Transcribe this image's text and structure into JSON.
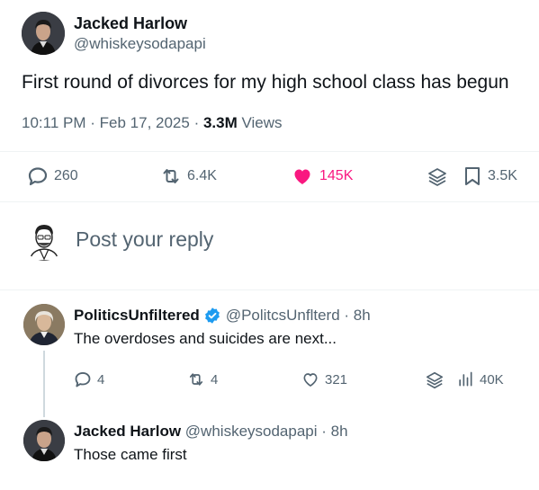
{
  "tweet": {
    "author_name": "Jacked Harlow",
    "author_handle": "@whiskeysodapapi",
    "text": "First round of divorces for my high school class has begun",
    "time": "10:11 PM",
    "date": "Feb 17, 2025",
    "views_count": "3.3M",
    "views_label": "Views",
    "replies": "260",
    "reposts": "6.4K",
    "likes": "145K",
    "bookmarks": "3.5K"
  },
  "compose": {
    "placeholder": "Post your reply"
  },
  "replies": [
    {
      "author_name": "PoliticsUnfiltered",
      "author_handle": "@PolitcsUnflterd",
      "time": "8h",
      "text": "The overdoses and suicides are next...",
      "replies": "4",
      "reposts": "4",
      "likes": "321",
      "views": "40K"
    },
    {
      "author_name": "Jacked Harlow",
      "author_handle": "@whiskeysodapapi",
      "time": "8h",
      "text": "Those came first"
    }
  ],
  "colors": {
    "like_pink": "#f91880",
    "verified_blue": "#1d9bf0",
    "secondary_text": "#536471"
  }
}
